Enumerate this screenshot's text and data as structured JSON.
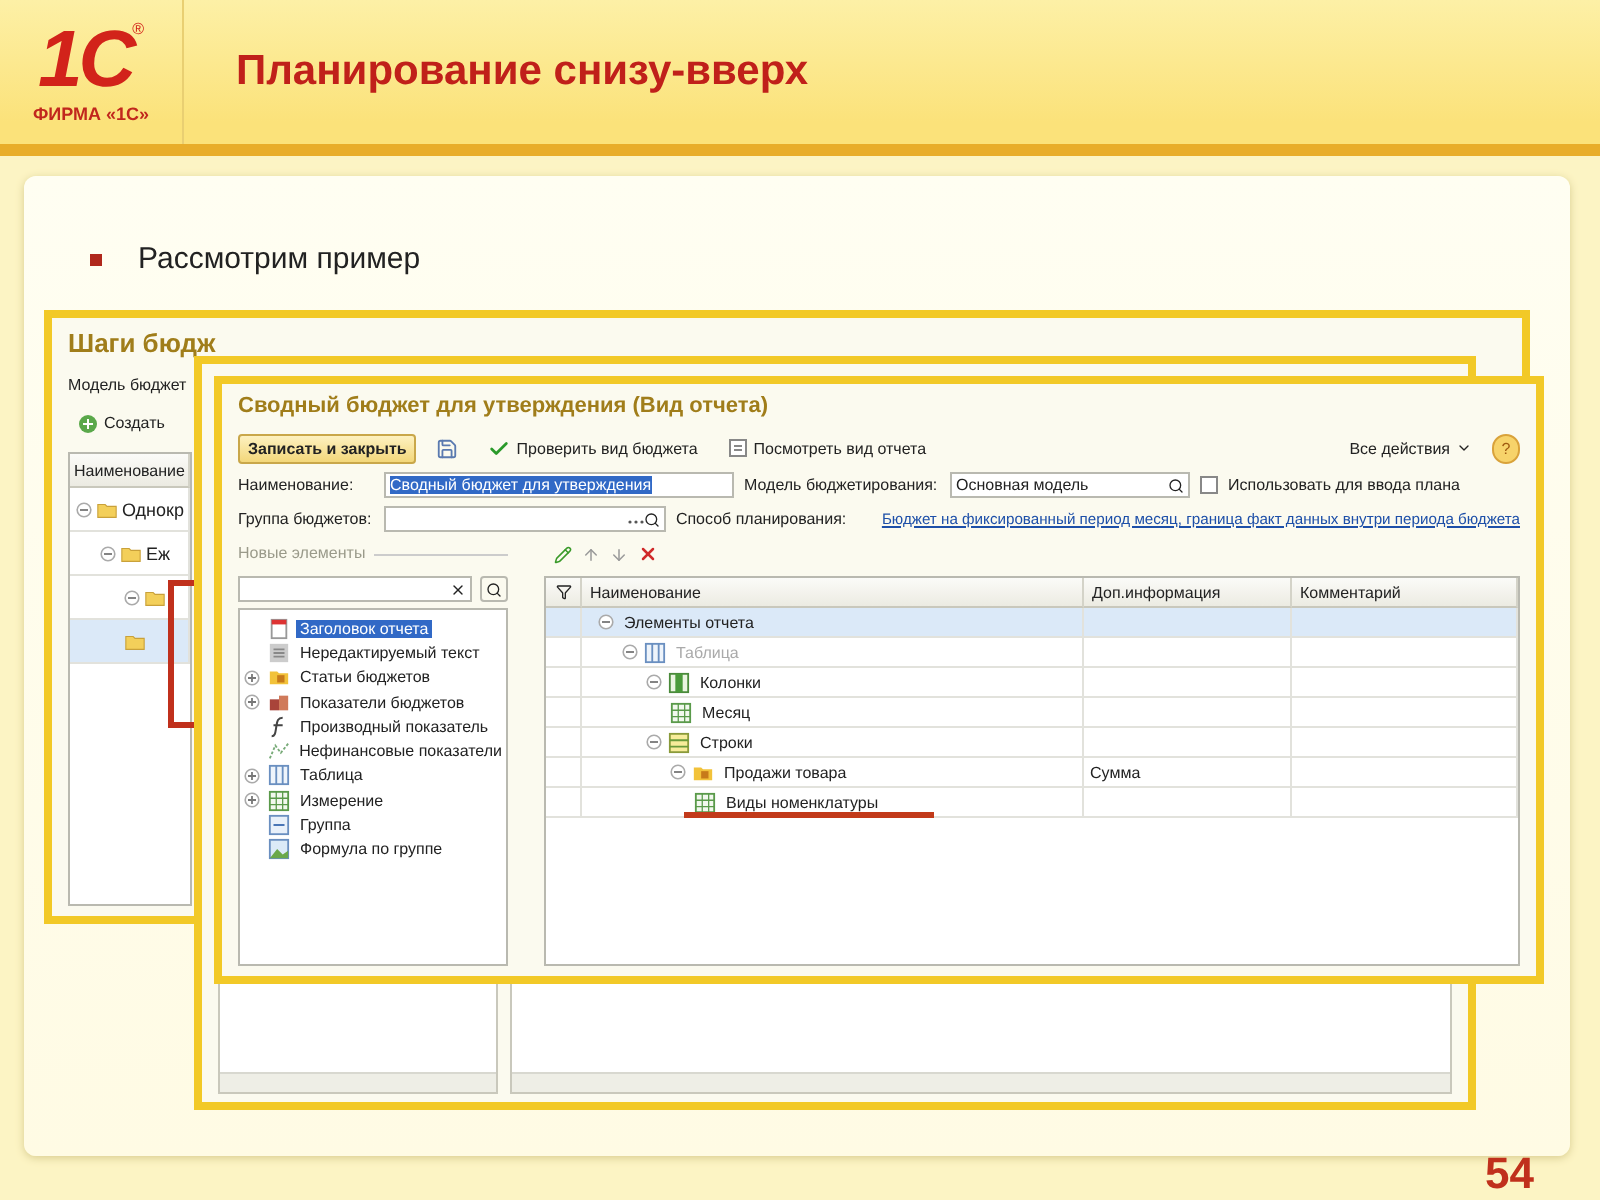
{
  "slide": {
    "logo": {
      "mark": "1С",
      "registered": "®",
      "caption": "ФИРМА «1С»"
    },
    "title": "Планирование снизу-вверх",
    "bullets": [
      "Рассмотрим пример"
    ],
    "page_number": "54"
  },
  "back_window": {
    "title": "Шаги бюдж",
    "model_label": "Модель бюджет",
    "create_button": "Создать",
    "column": "Наименование",
    "rows": [
      {
        "name": "Однокр",
        "expanded": true,
        "selected": false,
        "children": [
          {
            "name": "Еж",
            "expanded": true,
            "selected": false,
            "children": [
              {
                "expanded": true,
                "selected": false
              },
              {
                "selected": true
              }
            ]
          }
        ]
      }
    ]
  },
  "main_window": {
    "title": "Сводный бюджет для утверждения (Вид отчета)",
    "toolbar": [
      {
        "kind": "primary",
        "label": "Записать и закрыть"
      },
      {
        "kind": "save"
      },
      {
        "kind": "check",
        "label": "Проверить вид бюджета"
      },
      {
        "kind": "view",
        "label": "Посмотреть вид отчета"
      }
    ],
    "all_actions": "Все действия",
    "help": "?",
    "fields": {
      "name_label": "Наименование:",
      "name_value": "Сводный бюджет для утверждения",
      "group_label": "Группа бюджетов:",
      "model_label": "Модель бюджетирования:",
      "model_value": "Основная модель",
      "plan_checkbox": {
        "label": "Использовать для ввода плана",
        "checked": false
      },
      "method_label": "Способ планирования:",
      "method_link": "Бюджет на фиксированный период месяц, граница факт данных внутри периода бюджета"
    },
    "palette": {
      "title": "Новые элементы",
      "items": [
        {
          "label": "Заголовок отчета",
          "kind": "header",
          "expandable": false,
          "selected": true
        },
        {
          "label": "Нередактируемый текст",
          "kind": "text",
          "expandable": false,
          "selected": false
        },
        {
          "label": "Статьи бюджетов",
          "kind": "articles",
          "expandable": true,
          "selected": false
        },
        {
          "label": "Показатели бюджетов",
          "kind": "indicators",
          "expandable": true,
          "selected": false
        },
        {
          "label": "Производный показатель",
          "kind": "formula",
          "expandable": false,
          "selected": false
        },
        {
          "label": "Нефинансовые показатели",
          "kind": "nonfinancial",
          "expandable": false,
          "selected": false
        },
        {
          "label": "Таблица",
          "kind": "table",
          "expandable": true,
          "selected": false
        },
        {
          "label": "Измерение",
          "kind": "dimension",
          "expandable": true,
          "selected": false
        },
        {
          "label": "Группа",
          "kind": "group",
          "expandable": false,
          "selected": false
        },
        {
          "label": "Формула по группе",
          "kind": "groupformula",
          "expandable": false,
          "selected": false
        }
      ]
    },
    "structure": {
      "columns": [
        "Наименование",
        "Доп.информация",
        "Комментарий"
      ],
      "rows": [
        {
          "name": "Элементы отчета",
          "expanded": true,
          "selected": true,
          "disabled": false,
          "marked": false,
          "children": [
            {
              "name": "Таблица",
              "kind": "table",
              "expanded": true,
              "selected": false,
              "disabled": true,
              "marked": false,
              "children": [
                {
                  "name": "Колонки",
                  "kind": "columns",
                  "expanded": true,
                  "selected": false,
                  "disabled": false,
                  "marked": false,
                  "children": [
                    {
                      "name": "Месяц",
                      "kind": "dimension",
                      "selected": false,
                      "disabled": false,
                      "marked": false
                    }
                  ]
                },
                {
                  "name": "Строки",
                  "kind": "rows",
                  "expanded": true,
                  "selected": false,
                  "disabled": false,
                  "marked": false,
                  "children": [
                    {
                      "name": "Продажи товара",
                      "info": "Сумма",
                      "kind": "articles",
                      "expanded": true,
                      "selected": false,
                      "disabled": false,
                      "marked": false,
                      "children": [
                        {
                          "name": "Виды номенклатуры",
                          "kind": "dimension",
                          "selected": false,
                          "disabled": false,
                          "marked": true
                        }
                      ]
                    }
                  ]
                }
              ]
            }
          ]
        }
      ]
    }
  }
}
